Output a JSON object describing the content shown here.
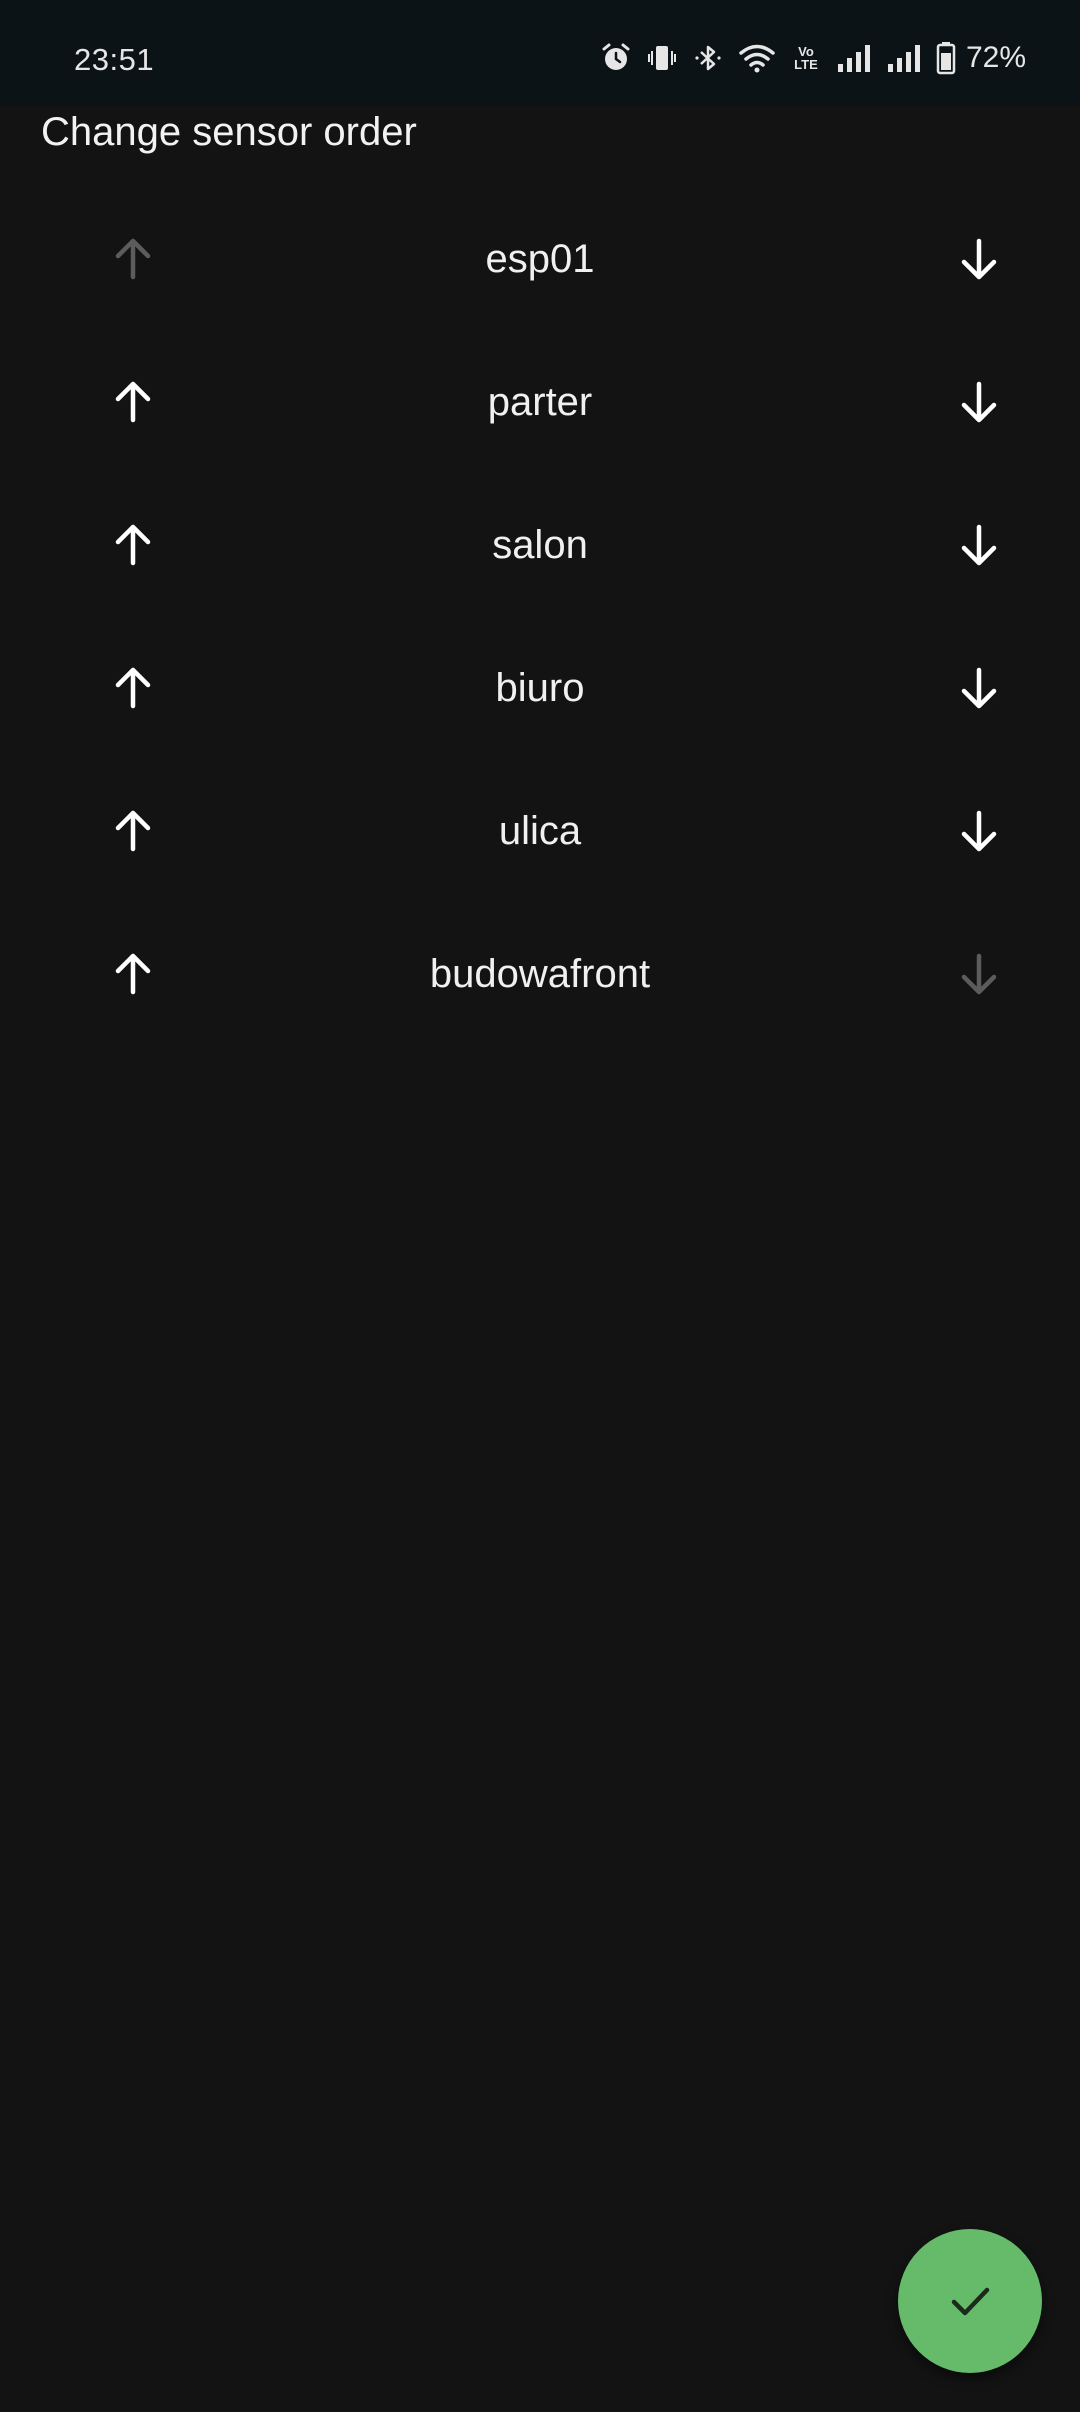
{
  "status_bar": {
    "time": "23:51",
    "battery_percent": "72%",
    "volte_label": "Vo LTE",
    "icons": [
      "alarm-icon",
      "vibrate-icon",
      "bluetooth-icon",
      "wifi-icon",
      "volte-icon",
      "signal-icon",
      "signal-icon",
      "battery-icon"
    ]
  },
  "title": "Change sensor order",
  "sensors": [
    {
      "name": "esp01",
      "up_enabled": false,
      "down_enabled": true
    },
    {
      "name": "parter",
      "up_enabled": true,
      "down_enabled": true
    },
    {
      "name": "salon",
      "up_enabled": true,
      "down_enabled": true
    },
    {
      "name": "biuro",
      "up_enabled": true,
      "down_enabled": true
    },
    {
      "name": "ulica",
      "up_enabled": true,
      "down_enabled": true
    },
    {
      "name": "budowafront",
      "up_enabled": true,
      "down_enabled": false
    }
  ],
  "fab": {
    "icon": "check-icon",
    "color": "#66bb6a"
  },
  "colors": {
    "background": "#131313",
    "status_bar": "#0c1316",
    "disabled_arrow": "#5c5c5c",
    "accent": "#66bb6a"
  }
}
